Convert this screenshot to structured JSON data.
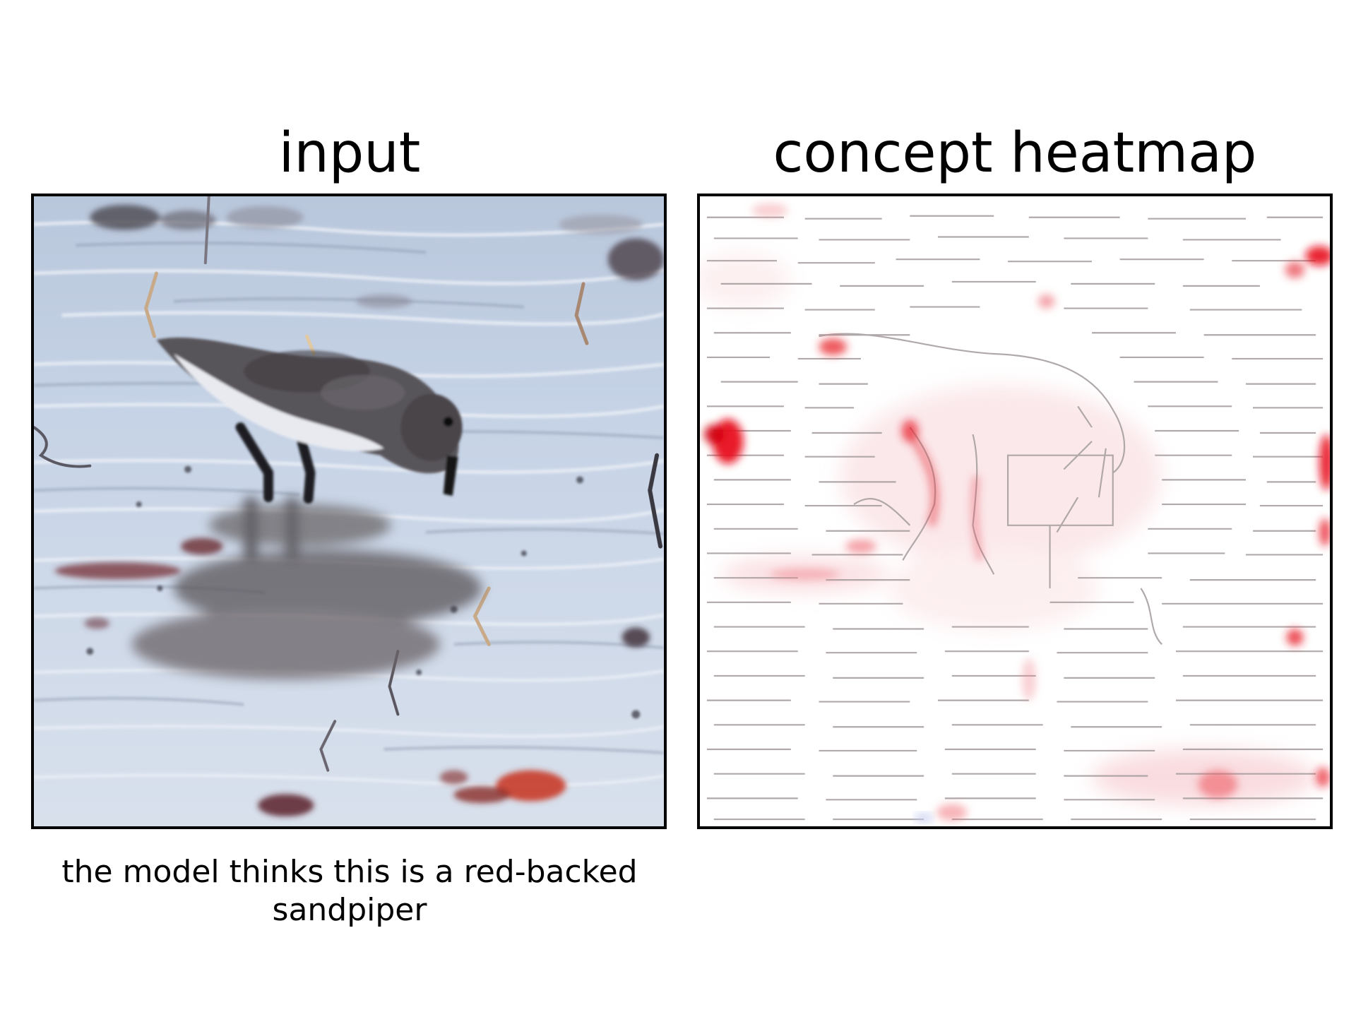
{
  "panels": {
    "left": {
      "title": "input"
    },
    "right": {
      "title": "concept heatmap"
    }
  },
  "caption": "the model thinks this is a red-backed sandpiper",
  "colors": {
    "water": "#c9d6e8",
    "bird_dark": "#4e4a4c",
    "bird_light": "#e6e8ee",
    "heat_red": "#e8202a",
    "contour": "#9a9a9a"
  }
}
